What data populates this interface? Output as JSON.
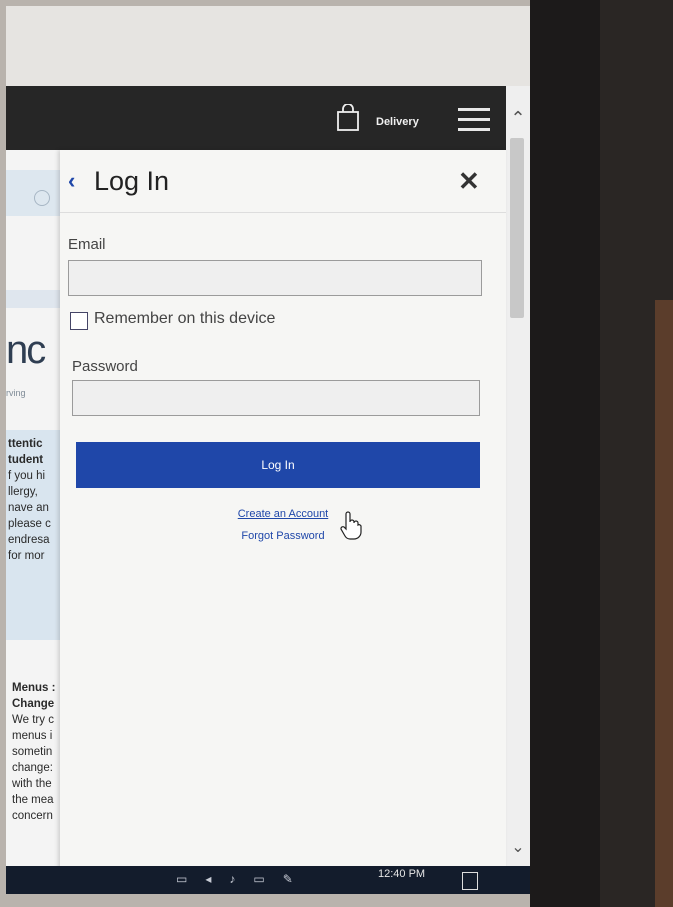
{
  "header": {
    "delivery_label": "Delivery"
  },
  "background_page": {
    "logo_text": "nc",
    "logo_sub": "rving",
    "attention_lines": [
      "ttentic",
      "tudent",
      "f you hi",
      "llergy,",
      "nave an",
      "please c",
      "endresa",
      "for mor"
    ],
    "menus_lines": [
      "Menus :",
      "Change",
      "We try c",
      "menus i",
      "sometin",
      "change:",
      "with the",
      "the mea",
      "concern"
    ]
  },
  "login": {
    "title": "Log In",
    "email_label": "Email",
    "email_value": "",
    "remember_label": "Remember on this device",
    "remember_checked": false,
    "password_label": "Password",
    "password_value": "",
    "login_button": "Log In",
    "create_account_link": "Create an Account",
    "forgot_password_link": "Forgot Password"
  },
  "taskbar": {
    "time": "12:40 PM"
  },
  "colors": {
    "accent": "#1f47a9",
    "header_bg": "#262626",
    "taskbar_bg": "#131c2c"
  },
  "icons": [
    "shopping-bag-icon",
    "hamburger-menu-icon",
    "back-chevron-icon",
    "close-icon",
    "hand-cursor-icon"
  ]
}
